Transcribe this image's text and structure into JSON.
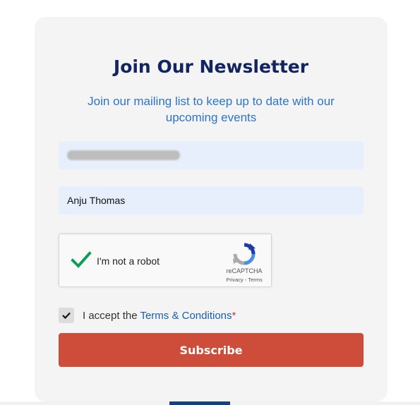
{
  "newsletter": {
    "title": "Join Our Newsletter",
    "subtitle": "Join our mailing list to keep up to date with our upcoming events",
    "email_value": "",
    "name_value": "Anju Thomas",
    "recaptcha": {
      "label": "I'm not a robot",
      "brand": "reCAPTCHA",
      "privacy": "Privacy",
      "separator": " - ",
      "terms": "Terms",
      "checked": true
    },
    "accept": {
      "prefix": "I accept the ",
      "link": "Terms & Conditions",
      "required_mark": "*",
      "checked": true
    },
    "subscribe_label": "Subscribe"
  },
  "colors": {
    "title": "#122560",
    "subtitle": "#2e74c7",
    "button": "#cd4c3a",
    "card": "#f4f4f4",
    "field": "#e7effc"
  }
}
